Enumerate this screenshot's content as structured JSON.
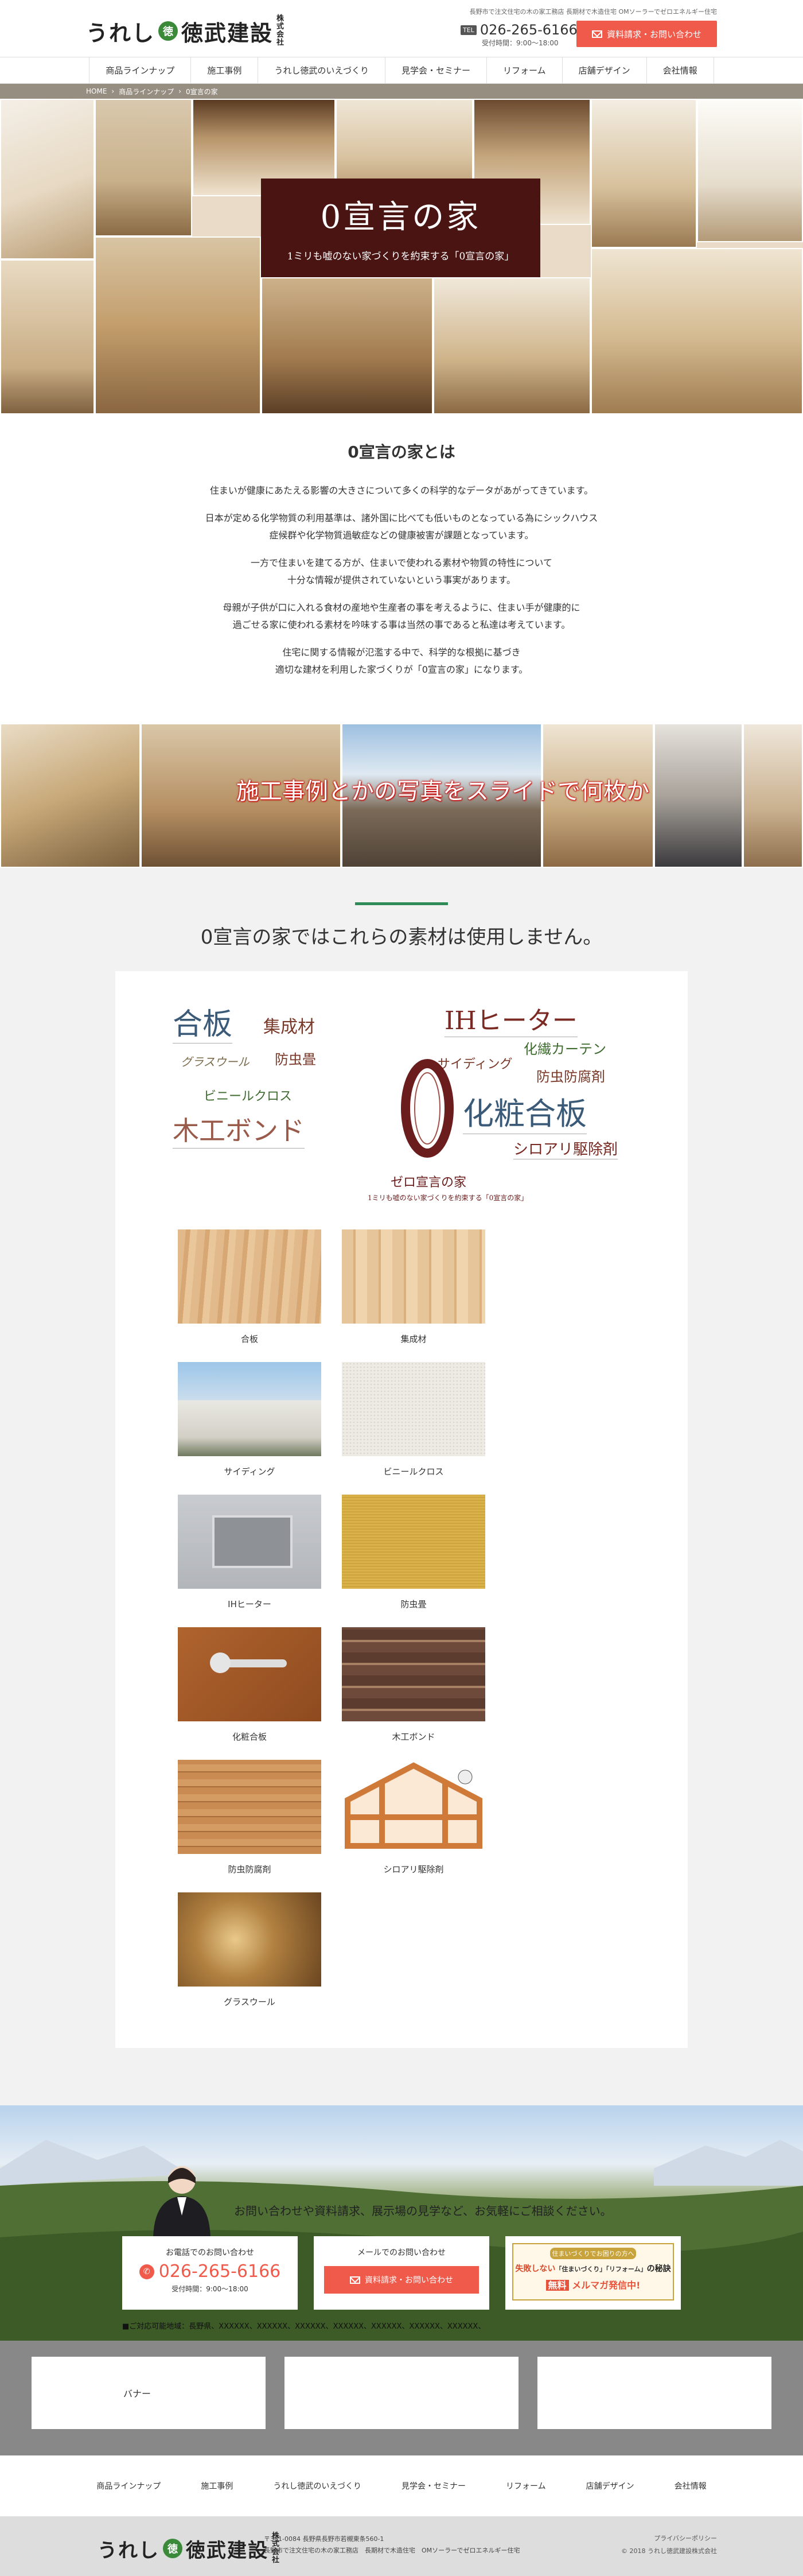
{
  "header": {
    "logo_main": "うれし",
    "logo_mid": "徳武建設",
    "logo_sub": "株式会社",
    "tagline": "長野市で注文住宅の木の家工務店 長期材で木造住宅 OMソーラーでゼロエネルギー住宅",
    "tel_badge": "TEL",
    "tel": "026-265-6166",
    "hours": "受付時間：9:00～18:00",
    "cta": "資料請求・お問い合わせ"
  },
  "nav": [
    "商品ラインナップ",
    "施工事例",
    "うれし徳武のいえづくり",
    "見学会・セミナー",
    "リフォーム",
    "店舗デザイン",
    "会社情報"
  ],
  "breadcrumb": [
    "HOME",
    "商品ラインナップ",
    "0宣言の家"
  ],
  "hero": {
    "title": "0宣言の家",
    "subtitle": "1ミリも嘘のない家づくりを約束する「0宣言の家」"
  },
  "concept": {
    "heading": "0宣言の家とは",
    "paragraphs": [
      [
        "住まいが健康にあたえる影響の大きさについて多くの科学的なデータがあがってきています。"
      ],
      [
        "日本が定める化学物質の利用基準は、諸外国に比べても低いものとなっている為にシックハウス",
        "症候群や化学物質過敏症などの健康被害が課題となっています。"
      ],
      [
        "一方で住まいを建てる方が、住まいで使われる素材や物質の特性について",
        "十分な情報が提供されていないという事実があります。"
      ],
      [
        "母親が子供が口に入れる食材の産地や生産者の事を考えるように、住まい手が健康的に",
        "過ごせる家に使われる素材を吟味する事は当然の事であると私達は考えています。"
      ],
      [
        "住宅に関する情報が氾濫する中で、科学的な根拠に基づき",
        "適切な建材を利用した家づくりが「0宣言の家」になります。"
      ]
    ]
  },
  "slide_caption": "施工事例とかの写真をスライドで何枚か",
  "materials": {
    "heading": "0宣言の家ではこれらの素材は使用しません。",
    "cloud": {
      "zero_label": "ゼロ宣言の家",
      "zero_sub": "1ミリも嘘のない家づくりを約束する「0宣言の家」",
      "words": [
        "合板",
        "集成材",
        "グラスウール",
        "防虫畳",
        "ビニールクロス",
        "木工ボンド",
        "IHヒーター",
        "サイディング",
        "化繊カーテン",
        "防虫防腐剤",
        "化粧合板",
        "シロアリ駆除剤"
      ]
    },
    "items": [
      "合板",
      "集成材",
      "サイディング",
      "ビニールクロス",
      "IHヒーター",
      "防虫畳",
      "化粧合板",
      "木工ボンド",
      "防虫防腐剤",
      "シロアリ駆除剤",
      "グラスウール"
    ]
  },
  "contact": {
    "lead": "お問い合わせや資料請求、展示場の見学など、お気軽にご相談ください。",
    "tel_title": "お電話でのお問い合わせ",
    "tel": "026-265-6166",
    "hours": "受付時間：9:00～18:00",
    "mail_title": "メールでのお問い合わせ",
    "mail_btn": "資料請求・お問い合わせ",
    "book_line1": "住まいづくりでお困りの方へ",
    "book_line2a": "失敗しない",
    "book_line2b": "「住まいづくり」「リフォーム」",
    "book_line2c": "の秘訣",
    "book_line3a": "無料",
    "book_line3b": "メルマガ発信中!",
    "area": "■ご対応可能地域：長野県、XXXXXX、XXXXXX、XXXXXX、XXXXXX、XXXXXX、XXXXXX、XXXXXX、"
  },
  "banners": [
    "バナー",
    "",
    ""
  ],
  "footer": {
    "nav": [
      "商品ラインナップ",
      "施工事例",
      "うれし徳武のいえづくり",
      "見学会・セミナー",
      "リフォーム",
      "店舗デザイン",
      "会社情報"
    ],
    "address1": "〒381-0084 長野県長野市若槻東条560-1",
    "address2": "長野市で注文住宅の木の家工務店　長期材で木造住宅　OMソーラーでゼロエネルギー住宅",
    "privacy": "プライバシーポリシー",
    "copyright": "© 2018 うれし徳武建設株式会社"
  },
  "colors": {
    "accent": "#ef5a4b",
    "hero_box": "#4a1413",
    "green_line": "#2e8b57",
    "zero_ring": "#6b1d1d"
  }
}
